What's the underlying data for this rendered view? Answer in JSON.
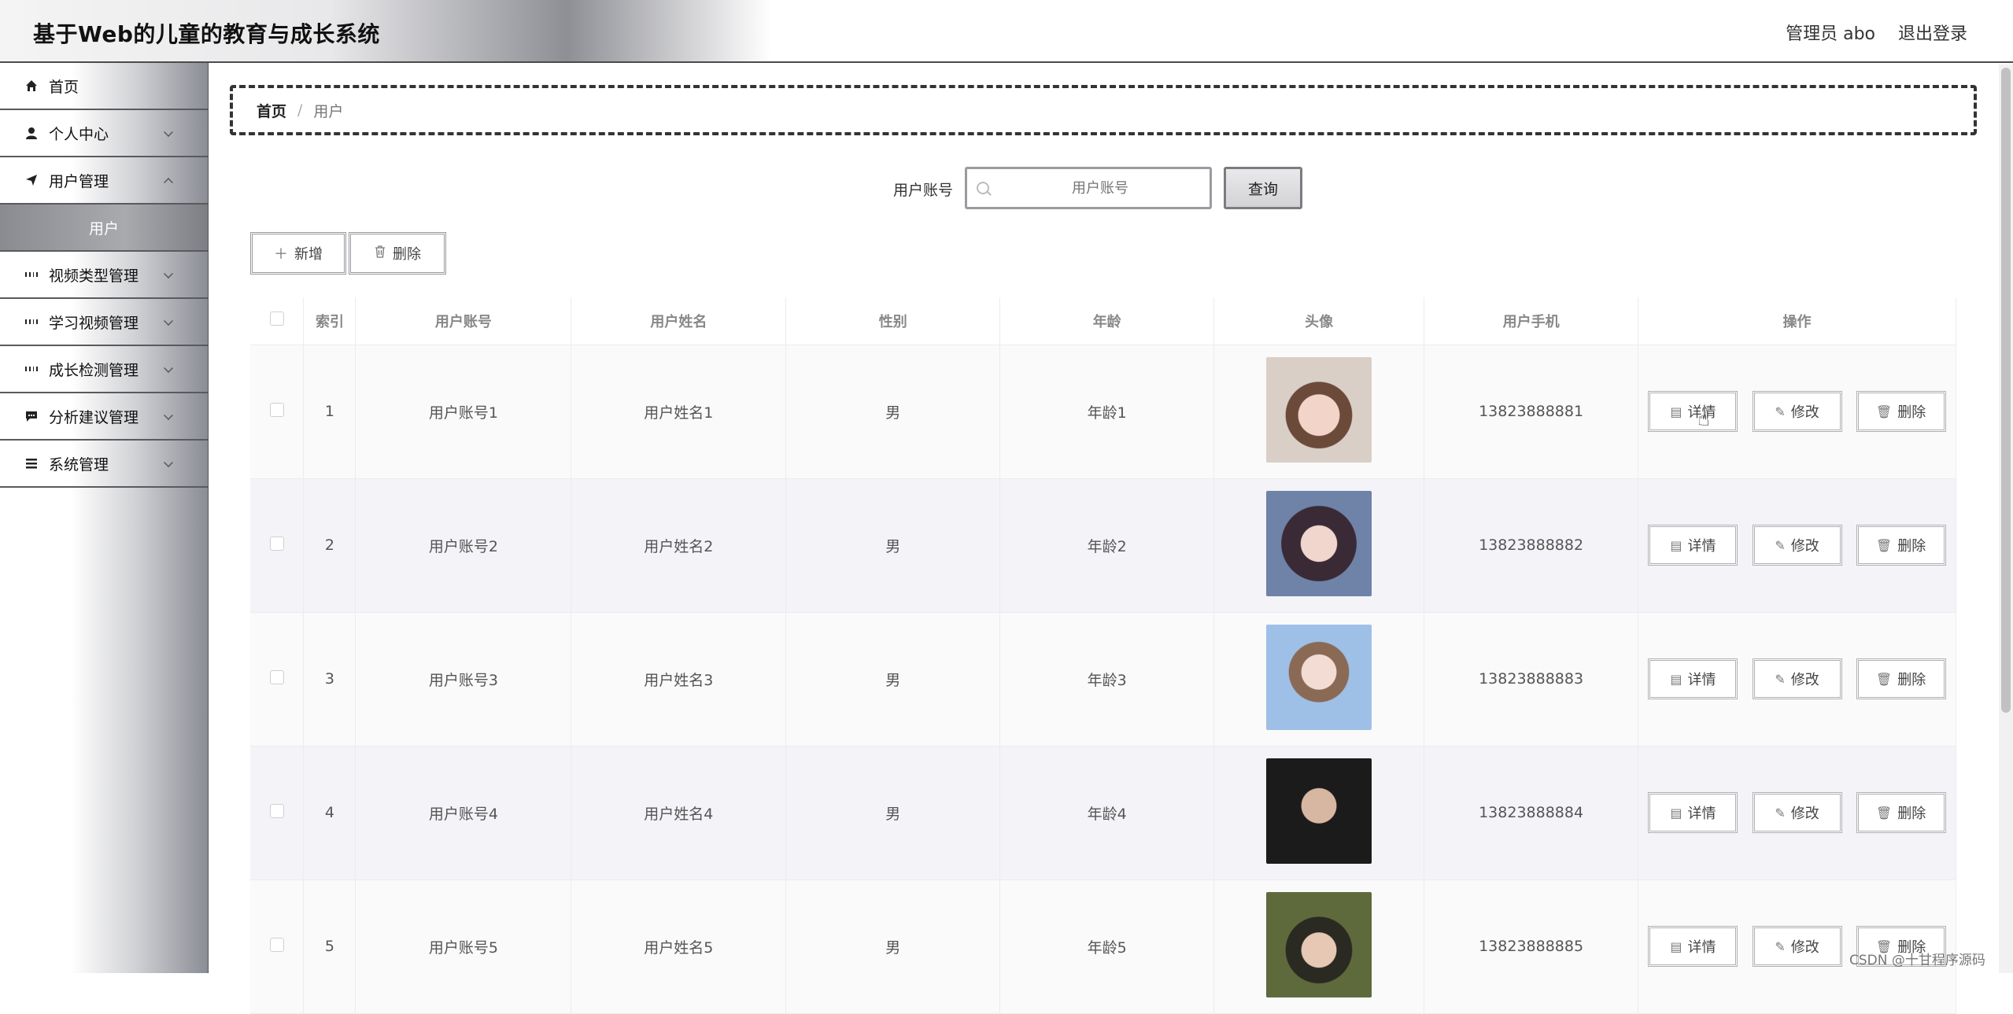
{
  "header": {
    "title": "基于Web的儿童的教育与成长系统",
    "user": "管理员 abo",
    "logout": "退出登录"
  },
  "sidebar": {
    "items": [
      {
        "label": "首页",
        "icon": "home-icon"
      },
      {
        "label": "个人中心",
        "icon": "user-icon"
      },
      {
        "label": "用户管理",
        "icon": "send-icon"
      },
      {
        "label": "用户",
        "icon": ""
      },
      {
        "label": "视频类型管理",
        "icon": "grid-icon"
      },
      {
        "label": "学习视频管理",
        "icon": "grid-icon"
      },
      {
        "label": "成长检测管理",
        "icon": "grid-icon"
      },
      {
        "label": "分析建议管理",
        "icon": "message-icon"
      },
      {
        "label": "系统管理",
        "icon": "menu-icon"
      }
    ]
  },
  "breadcrumb": {
    "home": "首页",
    "sep": "/",
    "current": "用户"
  },
  "search": {
    "label": "用户账号",
    "placeholder": "用户账号",
    "button": "查询"
  },
  "toolbar": {
    "add": "新增",
    "delete": "删除"
  },
  "table": {
    "headers": [
      "索引",
      "用户账号",
      "用户姓名",
      "性别",
      "年龄",
      "头像",
      "用户手机",
      "操作"
    ],
    "rows": [
      {
        "index": "1",
        "account": "用户账号1",
        "name": "用户姓名1",
        "gender": "男",
        "age": "年龄1",
        "phone": "13823888881"
      },
      {
        "index": "2",
        "account": "用户账号2",
        "name": "用户姓名2",
        "gender": "男",
        "age": "年龄2",
        "phone": "13823888882"
      },
      {
        "index": "3",
        "account": "用户账号3",
        "name": "用户姓名3",
        "gender": "男",
        "age": "年龄3",
        "phone": "13823888883"
      },
      {
        "index": "4",
        "account": "用户账号4",
        "name": "用户姓名4",
        "gender": "男",
        "age": "年龄4",
        "phone": "13823888884"
      },
      {
        "index": "5",
        "account": "用户账号5",
        "name": "用户姓名5",
        "gender": "男",
        "age": "年龄5",
        "phone": "13823888885"
      }
    ],
    "actions": {
      "detail": "详情",
      "edit": "修改",
      "delete": "删除"
    }
  },
  "watermark": "CSDN @十甘程序源码",
  "colors": {
    "header_mid": "#8e8f95",
    "sidebar_active": "#a9aaae",
    "border_dark": "#333333"
  }
}
